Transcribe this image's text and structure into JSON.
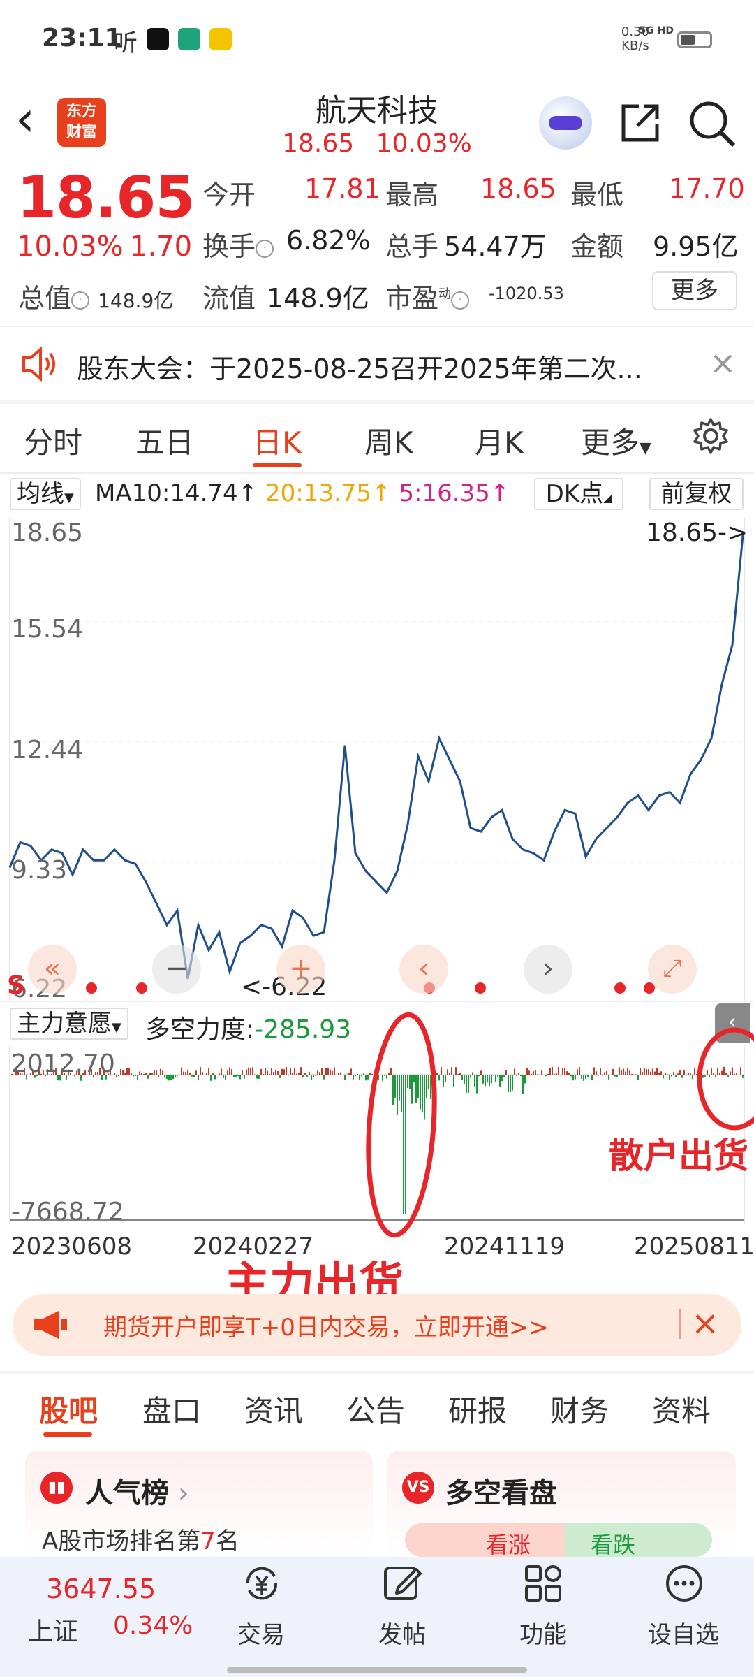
{
  "status_bar": {
    "time": "23:11",
    "ting": "听",
    "net_speed": "0.30",
    "net_unit": "KB/s",
    "signal": "5G HD"
  },
  "header": {
    "title": "航天科技",
    "price": "18.65",
    "change_pct": "10.03%",
    "logo_top": "东方",
    "logo_bottom": "财富"
  },
  "quote": {
    "price": "18.65",
    "change_pct": "10.03%",
    "change_amt": "1.70",
    "open_label": "今开",
    "open": "17.81",
    "high_label": "最高",
    "high": "18.65",
    "low_label": "最低",
    "low": "17.70",
    "turnover_label": "换手",
    "turnover": "6.82%",
    "volume_label": "总手",
    "volume": "54.47万",
    "amount_label": "金额",
    "amount": "9.95亿",
    "mktcap_label": "总值",
    "mktcap": "148.9亿",
    "float_label": "流值",
    "float": "148.9亿",
    "pe_label": "市盈",
    "pe_sup": "动",
    "pe": "-1020.53",
    "more_label": "更多"
  },
  "notice": {
    "text": "股东大会：于2025-08-25召开2025年第二次..."
  },
  "chart_tabs": [
    {
      "label": "分时"
    },
    {
      "label": "五日"
    },
    {
      "label": "日K"
    },
    {
      "label": "周K"
    },
    {
      "label": "月K"
    },
    {
      "label": "更多"
    }
  ],
  "ma_bar": {
    "selector": "均线",
    "ma10": "MA10:14.74",
    "ma20": "20:13.75",
    "ma5": "5:16.35",
    "up": "↑",
    "dk": "DK点",
    "fq": "前复权"
  },
  "colors": {
    "ma10": "#222222",
    "ma20": "#f0a500",
    "ma5": "#d0208a",
    "line": "#1f4e8c",
    "red": "#e8262a",
    "green": "#1a9a3a"
  },
  "price_chart": {
    "y_ticks": [
      "18.65",
      "15.54",
      "12.44",
      "9.33",
      "6.22"
    ],
    "last_marker": "18.65->",
    "min_marker": "<-6.22",
    "left_tag": "S"
  },
  "indicator": {
    "selector": "主力意愿",
    "label": "多空力度:",
    "value": "-285.93",
    "y_top": "2012.70",
    "y_bottom": "-7668.72"
  },
  "x_dates": [
    "20230608",
    "20240227",
    "20241119",
    "20250811"
  ],
  "annotations": {
    "main_force": "主力出货",
    "retail": "散户出货"
  },
  "chart_data": {
    "type": "line",
    "title": "",
    "xlabel": "",
    "ylabel": "",
    "x_ticks": [
      "20230608",
      "20240227",
      "20241119",
      "20250811"
    ],
    "ylim": [
      6.22,
      18.65
    ],
    "y_ticks": [
      18.65,
      15.54,
      12.44,
      9.33,
      6.22
    ],
    "series": [
      {
        "values": [
          9.4,
          10.1,
          10.0,
          9.6,
          9.9,
          9.8,
          9.2,
          9.9,
          9.6,
          9.6,
          9.9,
          9.6,
          9.5,
          9.0,
          8.4,
          7.8,
          8.2,
          6.3,
          7.8,
          7.1,
          7.6,
          6.5,
          7.3,
          7.5,
          7.8,
          7.7,
          7.2,
          8.2,
          8.0,
          7.5,
          7.6,
          9.6,
          12.8,
          9.8,
          9.3,
          9.0,
          8.7,
          9.3,
          10.6,
          12.5,
          11.8,
          13.0,
          12.4,
          11.8,
          10.5,
          10.4,
          10.8,
          11.0,
          10.2,
          9.9,
          9.8,
          9.6,
          10.4,
          11.0,
          10.9,
          9.7,
          10.2,
          10.5,
          10.8,
          11.2,
          11.4,
          11.0,
          11.4,
          11.5,
          11.2,
          12.0,
          12.4,
          13.0,
          14.5,
          15.6,
          18.65
        ]
      }
    ]
  },
  "ad": {
    "text": "期货开户即享T+0日内交易，立即开通>>"
  },
  "section_tabs": [
    {
      "label": "股吧"
    },
    {
      "label": "盘口"
    },
    {
      "label": "资讯"
    },
    {
      "label": "公告"
    },
    {
      "label": "研报"
    },
    {
      "label": "财务"
    },
    {
      "label": "资料"
    }
  ],
  "cards": {
    "popularity_title": "人气榜",
    "popularity_desc_prefix": "A股市场排名第",
    "popularity_rank": "7",
    "popularity_desc_suffix": "名",
    "vs_title": "多空看盘",
    "vs_badge": "VS",
    "bull": "看涨",
    "bear": "看跌"
  },
  "bottom_nav": {
    "index_value": "3647.55",
    "index_name": "上证",
    "index_change": "0.34%",
    "trade": "交易",
    "post": "发帖",
    "func": "功能",
    "watch": "设自选"
  }
}
